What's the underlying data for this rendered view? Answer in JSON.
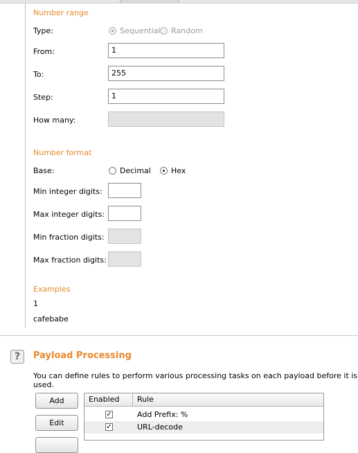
{
  "number_range": {
    "section_title": "Number range",
    "type_label": "Type:",
    "type_options": [
      {
        "label": "Sequential",
        "selected": true,
        "enabled": false
      },
      {
        "label": "Random",
        "selected": false,
        "enabled": false
      }
    ],
    "from_label": "From:",
    "from_value": "1",
    "to_label": "To:",
    "to_value": "255",
    "step_label": "Step:",
    "step_value": "1",
    "how_many_label": "How many:",
    "how_many_value": ""
  },
  "number_format": {
    "section_title": "Number format",
    "base_label": "Base:",
    "base_options": [
      {
        "label": "Decimal",
        "selected": false
      },
      {
        "label": "Hex",
        "selected": true
      }
    ],
    "min_integer_label": "Min integer digits:",
    "min_integer_value": "",
    "max_integer_label": "Max integer digits:",
    "max_integer_value": "",
    "min_fraction_label": "Min fraction digits:",
    "min_fraction_value": "",
    "max_fraction_label": "Max fraction digits:",
    "max_fraction_value": ""
  },
  "examples": {
    "section_title": "Examples",
    "items": [
      "1",
      "cafebabe"
    ]
  },
  "payload_processing": {
    "help_icon": "?",
    "title": "Payload Processing",
    "description": "You can define rules to perform various processing tasks on each payload before it is used.",
    "buttons": {
      "add": "Add",
      "edit": "Edit"
    },
    "table": {
      "columns": [
        "Enabled",
        "Rule"
      ],
      "rows": [
        {
          "enabled": true,
          "rule": "Add Prefix: %"
        },
        {
          "enabled": true,
          "rule": "URL-decode"
        }
      ]
    }
  },
  "colors": {
    "section_accent": "#e8892b"
  }
}
